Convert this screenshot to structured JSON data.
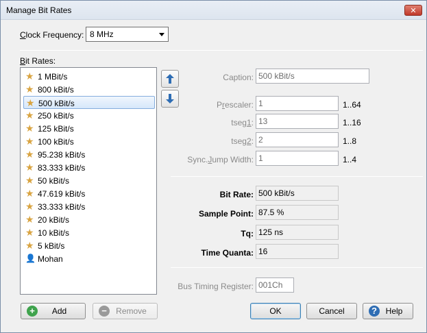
{
  "window": {
    "title": "Manage Bit Rates",
    "close_symbol": "✕"
  },
  "clock": {
    "label_accel": "C",
    "label_rest": "lock Frequency:",
    "value": "8 MHz"
  },
  "bitrates": {
    "label_accel": "B",
    "label_rest": "it Rates:",
    "items": [
      {
        "label": "1 MBit/s",
        "icon": "star-icon"
      },
      {
        "label": "800 kBit/s",
        "icon": "star-icon"
      },
      {
        "label": "500 kBit/s",
        "icon": "star-icon",
        "selected": true
      },
      {
        "label": "250 kBit/s",
        "icon": "star-icon"
      },
      {
        "label": "125 kBit/s",
        "icon": "star-icon"
      },
      {
        "label": "100 kBit/s",
        "icon": "star-icon"
      },
      {
        "label": "95.238 kBit/s",
        "icon": "star-icon"
      },
      {
        "label": "83.333 kBit/s",
        "icon": "star-icon"
      },
      {
        "label": "50 kBit/s",
        "icon": "star-icon"
      },
      {
        "label": "47.619 kBit/s",
        "icon": "star-icon"
      },
      {
        "label": "33.333 kBit/s",
        "icon": "star-icon"
      },
      {
        "label": "20 kBit/s",
        "icon": "star-icon"
      },
      {
        "label": "10 kBit/s",
        "icon": "star-icon"
      },
      {
        "label": "5 kBit/s",
        "icon": "star-icon"
      },
      {
        "label": "Mohan",
        "icon": "user-icon"
      }
    ]
  },
  "settings": {
    "caption": {
      "label_pre": "Caption",
      "label_post": ":",
      "value": "500 kBit/s"
    },
    "prescaler": {
      "label_pre": "P",
      "label_accel": "r",
      "label_post": "escaler:",
      "value": "1",
      "range": "1..64"
    },
    "tseg1": {
      "label_pre": "tseg",
      "label_accel": "1",
      "label_post": ":",
      "value": "13",
      "range": "1..16"
    },
    "tseg2": {
      "label_pre": "tseg",
      "label_accel": "2",
      "label_post": ":",
      "value": "2",
      "range": "1..8"
    },
    "sjw": {
      "label_pre": "Sync.",
      "label_accel": "J",
      "label_post": "ump Width:",
      "value": "1",
      "range": "1..4"
    }
  },
  "results": {
    "bit_rate": {
      "label": "Bit Rate:",
      "value": "500 kBit/s"
    },
    "sample_point": {
      "label": "Sample Point:",
      "value": "87.5 %"
    },
    "tq": {
      "label": "Tq:",
      "value": "125 ns"
    },
    "time_quanta": {
      "label": "Time Quanta:",
      "value": "16"
    }
  },
  "btr": {
    "label": "Bus Timing Register:",
    "value": "001Ch"
  },
  "buttons": {
    "add": "Add",
    "remove": "Remove",
    "ok": "OK",
    "cancel": "Cancel",
    "help": "Help"
  },
  "colors": {
    "star": "#d9a441",
    "user": "#3a6ea5",
    "add_icon": "#3fa34d",
    "remove_icon": "#9a9a9a",
    "help_icon": "#2e6db4",
    "arrow": "#2e6db4"
  }
}
